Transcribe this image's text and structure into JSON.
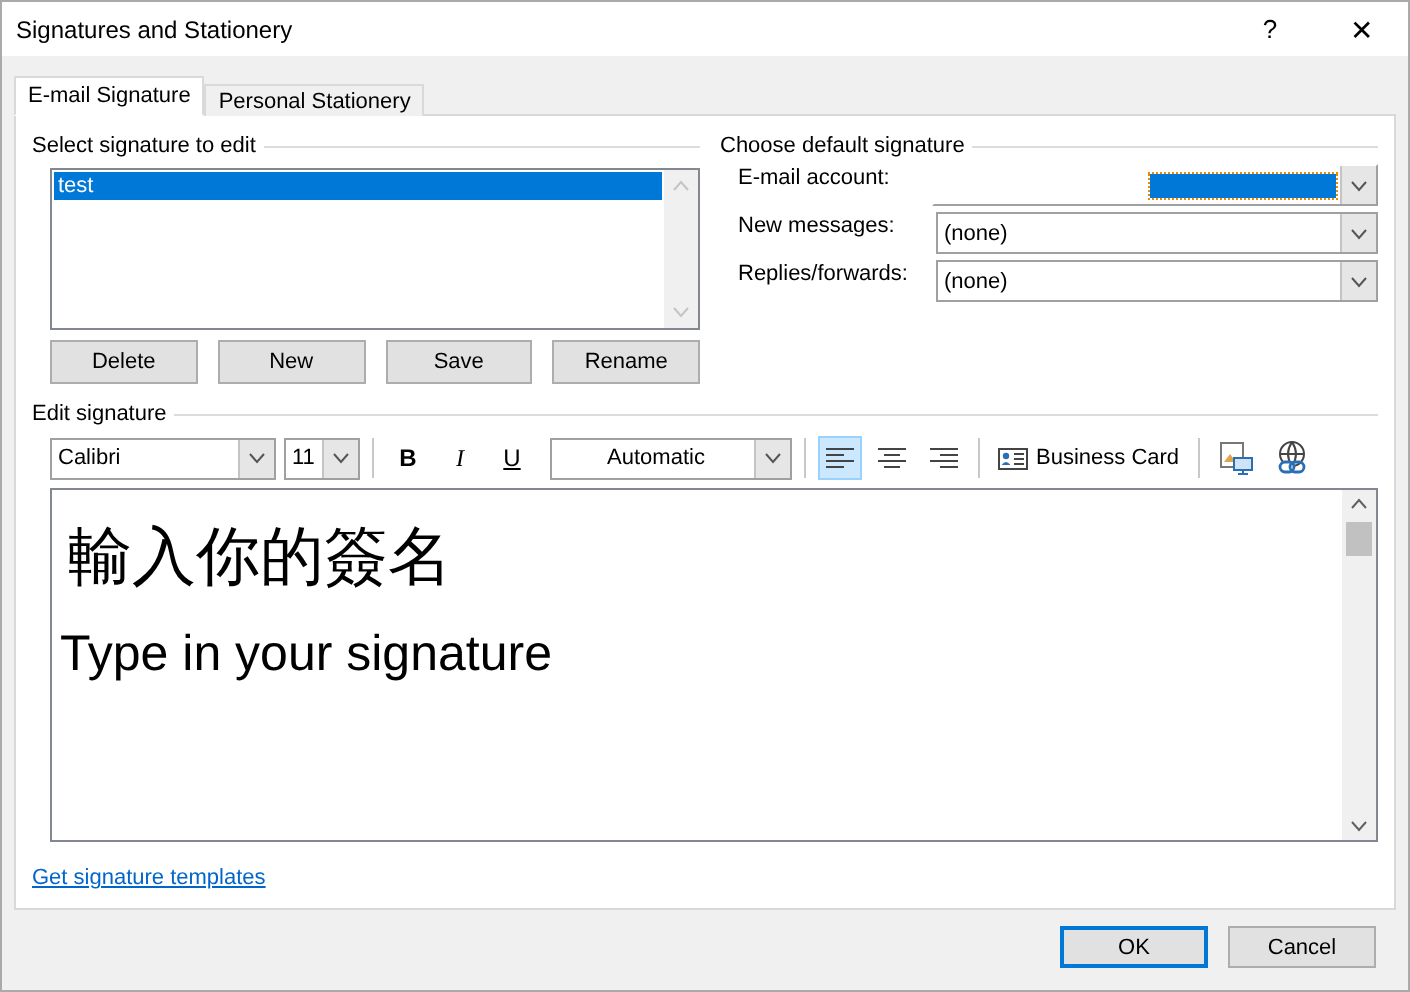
{
  "window": {
    "title": "Signatures and Stationery",
    "help": "?",
    "close": "✕"
  },
  "tabs": [
    {
      "label": "E-mail Signature",
      "selected": true
    },
    {
      "label": "Personal Stationery",
      "selected": false
    }
  ],
  "select_signature": {
    "heading": "Select signature to edit",
    "items": [
      {
        "label": "test",
        "selected": true
      }
    ],
    "buttons": [
      "Delete",
      "New",
      "Save",
      "Rename"
    ]
  },
  "default_signature": {
    "heading": "Choose default signature",
    "fields": [
      {
        "label": "E-mail account:",
        "kind": "highlighted"
      },
      {
        "label": "New messages:",
        "value": "(none)",
        "kind": "plain"
      },
      {
        "label": "Replies/forwards:",
        "value": "(none)",
        "kind": "plain"
      }
    ]
  },
  "edit_signature": {
    "heading": "Edit signature",
    "font": "Calibri",
    "size": "11",
    "bold": "B",
    "italic": "I",
    "underline": "U",
    "font_color": "Automatic",
    "align": [
      {
        "kind": "left",
        "selected": true
      },
      {
        "kind": "center",
        "selected": false
      },
      {
        "kind": "right",
        "selected": false
      }
    ],
    "business_card": "Business Card",
    "lines": [
      {
        "text": "輸入你的簽名",
        "kind": "large"
      },
      {
        "text": "Type in your signature",
        "kind": "medium"
      }
    ]
  },
  "templates_link": "Get signature templates",
  "buttons": [
    "OK",
    "Cancel"
  ]
}
